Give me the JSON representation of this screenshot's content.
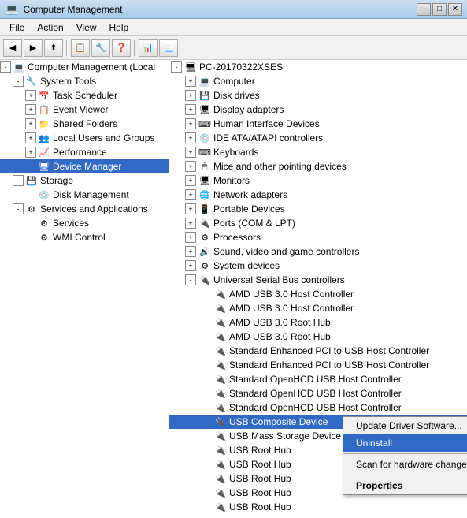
{
  "window": {
    "title": "Computer Management",
    "icon": "💻"
  },
  "titlebar_buttons": {
    "minimize": "—",
    "maximize": "□",
    "close": "✕"
  },
  "menubar": {
    "items": [
      "File",
      "Action",
      "View",
      "Help"
    ]
  },
  "toolbar": {
    "buttons": [
      "◀",
      "▶",
      "⬆",
      "📋",
      "🔧",
      "🔍"
    ]
  },
  "left_pane": {
    "root_label": "Computer Management (Local",
    "items": [
      {
        "id": "system-tools",
        "label": "System Tools",
        "level": 1,
        "expanded": true,
        "has_expander": true
      },
      {
        "id": "task-scheduler",
        "label": "Task Scheduler",
        "level": 2,
        "expanded": false,
        "has_expander": true
      },
      {
        "id": "event-viewer",
        "label": "Event Viewer",
        "level": 2,
        "expanded": false,
        "has_expander": true
      },
      {
        "id": "shared-folders",
        "label": "Shared Folders",
        "level": 2,
        "expanded": false,
        "has_expander": true
      },
      {
        "id": "local-users",
        "label": "Local Users and Groups",
        "level": 2,
        "expanded": false,
        "has_expander": true
      },
      {
        "id": "performance",
        "label": "Performance",
        "level": 2,
        "expanded": false,
        "has_expander": true
      },
      {
        "id": "device-manager",
        "label": "Device Manager",
        "level": 2,
        "expanded": false,
        "has_expander": false,
        "selected": true
      },
      {
        "id": "storage",
        "label": "Storage",
        "level": 1,
        "expanded": true,
        "has_expander": true
      },
      {
        "id": "disk-management",
        "label": "Disk Management",
        "level": 2,
        "expanded": false,
        "has_expander": false
      },
      {
        "id": "services-apps",
        "label": "Services and Applications",
        "level": 1,
        "expanded": true,
        "has_expander": true
      },
      {
        "id": "services",
        "label": "Services",
        "level": 2,
        "expanded": false,
        "has_expander": false
      },
      {
        "id": "wmi-control",
        "label": "WMI Control",
        "level": 2,
        "expanded": false,
        "has_expander": false
      }
    ]
  },
  "right_pane": {
    "root_label": "PC-20170322XSES",
    "items": [
      {
        "id": "computer",
        "label": "Computer",
        "level": 1,
        "has_expander": true,
        "expanded": false
      },
      {
        "id": "disk-drives",
        "label": "Disk drives",
        "level": 1,
        "has_expander": true,
        "expanded": false
      },
      {
        "id": "display-adapters",
        "label": "Display adapters",
        "level": 1,
        "has_expander": true,
        "expanded": false
      },
      {
        "id": "human-interface",
        "label": "Human Interface Devices",
        "level": 1,
        "has_expander": true,
        "expanded": false
      },
      {
        "id": "ide-atapi",
        "label": "IDE ATA/ATAPI controllers",
        "level": 1,
        "has_expander": true,
        "expanded": false
      },
      {
        "id": "keyboards",
        "label": "Keyboards",
        "level": 1,
        "has_expander": true,
        "expanded": false
      },
      {
        "id": "mice",
        "label": "Mice and other pointing devices",
        "level": 1,
        "has_expander": true,
        "expanded": false
      },
      {
        "id": "monitors",
        "label": "Monitors",
        "level": 1,
        "has_expander": true,
        "expanded": false
      },
      {
        "id": "network-adapters",
        "label": "Network adapters",
        "level": 1,
        "has_expander": true,
        "expanded": false
      },
      {
        "id": "portable-devices",
        "label": "Portable Devices",
        "level": 1,
        "has_expander": true,
        "expanded": false
      },
      {
        "id": "ports-com-lpt",
        "label": "Ports (COM & LPT)",
        "level": 1,
        "has_expander": true,
        "expanded": false
      },
      {
        "id": "processors",
        "label": "Processors",
        "level": 1,
        "has_expander": true,
        "expanded": false
      },
      {
        "id": "sound-video",
        "label": "Sound, video and game controllers",
        "level": 1,
        "has_expander": true,
        "expanded": false
      },
      {
        "id": "system-devices",
        "label": "System devices",
        "level": 1,
        "has_expander": true,
        "expanded": false
      },
      {
        "id": "usb-controllers",
        "label": "Universal Serial Bus controllers",
        "level": 1,
        "has_expander": true,
        "expanded": true
      },
      {
        "id": "amd-usb-hc-1",
        "label": "AMD USB 3.0 Host Controller",
        "level": 2,
        "has_expander": false
      },
      {
        "id": "amd-usb-hc-2",
        "label": "AMD USB 3.0 Host Controller",
        "level": 2,
        "has_expander": false
      },
      {
        "id": "amd-usb-hub-1",
        "label": "AMD USB 3.0 Root Hub",
        "level": 2,
        "has_expander": false
      },
      {
        "id": "amd-usb-hub-2",
        "label": "AMD USB 3.0 Root Hub",
        "level": 2,
        "has_expander": false
      },
      {
        "id": "std-enh-pci-1",
        "label": "Standard Enhanced PCI to USB Host Controller",
        "level": 2,
        "has_expander": false
      },
      {
        "id": "std-enh-pci-2",
        "label": "Standard Enhanced PCI to USB Host Controller",
        "level": 2,
        "has_expander": false
      },
      {
        "id": "std-openhcd-1",
        "label": "Standard OpenHCD USB Host Controller",
        "level": 2,
        "has_expander": false
      },
      {
        "id": "std-openhcd-2",
        "label": "Standard OpenHCD USB Host Controller",
        "level": 2,
        "has_expander": false
      },
      {
        "id": "std-openhcd-3",
        "label": "Standard OpenHCD USB Host Controller",
        "level": 2,
        "has_expander": false
      },
      {
        "id": "usb-composite",
        "label": "USB Composite Device",
        "level": 2,
        "has_expander": false,
        "selected": true
      },
      {
        "id": "usb-mass-1",
        "label": "USB Mass Storage Device",
        "level": 2,
        "has_expander": false
      },
      {
        "id": "usb-root-1",
        "label": "USB Root Hub",
        "level": 2,
        "has_expander": false
      },
      {
        "id": "usb-root-2",
        "label": "USB Root Hub",
        "level": 2,
        "has_expander": false
      },
      {
        "id": "usb-root-3",
        "label": "USB Root Hub",
        "level": 2,
        "has_expander": false
      },
      {
        "id": "usb-root-4",
        "label": "USB Root Hub",
        "level": 2,
        "has_expander": false
      },
      {
        "id": "usb-root-hub",
        "label": "USB Root Hub",
        "level": 2,
        "has_expander": false
      }
    ]
  },
  "context_menu": {
    "items": [
      {
        "id": "update-driver",
        "label": "Update Driver Software...",
        "bold": false
      },
      {
        "id": "uninstall",
        "label": "Uninstall",
        "bold": false,
        "highlighted": true
      },
      {
        "separator": true
      },
      {
        "id": "scan-hardware",
        "label": "Scan for hardware changes",
        "bold": false
      },
      {
        "separator": true
      },
      {
        "id": "properties",
        "label": "Properties",
        "bold": true
      }
    ]
  },
  "icons": {
    "computer_mgmt": "💻",
    "system_tools": "🔧",
    "task_scheduler": "📅",
    "event_viewer": "📋",
    "shared_folders": "📁",
    "local_users": "👥",
    "performance": "📈",
    "device_manager": "🖥",
    "storage": "💾",
    "disk_management": "💿",
    "services_apps": "⚙",
    "services": "⚙",
    "wmi": "⚙",
    "pc": "🖥",
    "device": "⚙",
    "usb": "🔌"
  }
}
